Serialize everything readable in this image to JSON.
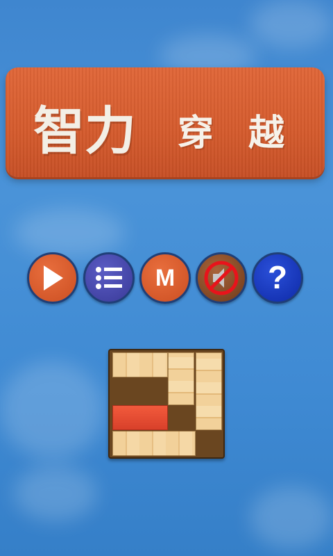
{
  "title": {
    "part1": "智力",
    "part2": "穿",
    "part3": "越"
  },
  "buttons": [
    {
      "id": "play",
      "icon": "play-icon"
    },
    {
      "id": "menu",
      "icon": "list-icon"
    },
    {
      "id": "more",
      "icon": "m-icon",
      "label": "M"
    },
    {
      "id": "sound",
      "icon": "sound-muted-icon"
    },
    {
      "id": "help",
      "icon": "question-icon",
      "label": "?"
    }
  ],
  "colors": {
    "board": "#d45a2c",
    "sky": "#4a93d8",
    "target_block": "#e8482f"
  }
}
